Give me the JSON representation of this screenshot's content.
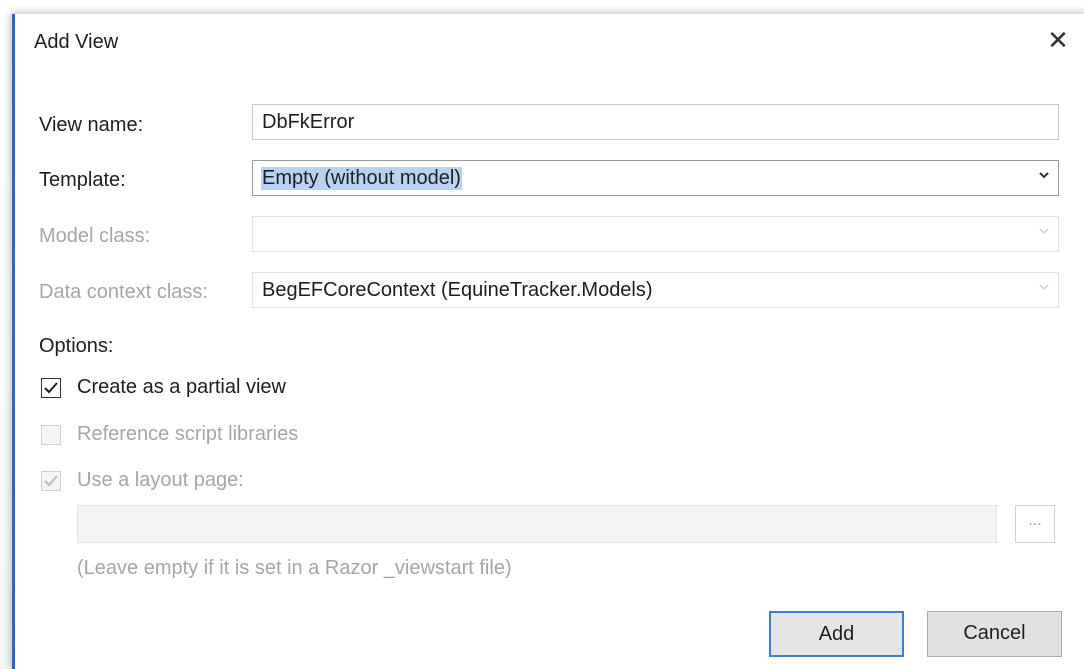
{
  "dialog": {
    "title": "Add View",
    "close_icon": "close-icon"
  },
  "form": {
    "view_name_label": "View name:",
    "view_name_value": "DbFkError",
    "template_label": "Template:",
    "template_value": "Empty (without model)",
    "model_class_label": "Model class:",
    "model_class_value": "",
    "data_context_label": "Data context class:",
    "data_context_value": "BegEFCoreContext (EquineTracker.Models)",
    "options_label": "Options:"
  },
  "options": {
    "partial_view": {
      "label": "Create as a partial view",
      "checked": true,
      "enabled": true
    },
    "script_libraries": {
      "label": "Reference script libraries",
      "checked": false,
      "enabled": false
    },
    "layout_page": {
      "label": "Use a layout page:",
      "checked": true,
      "enabled": false
    }
  },
  "layout": {
    "path_value": "",
    "browse_label": "...",
    "hint": "(Leave empty if it is set in a Razor _viewstart file)"
  },
  "buttons": {
    "add_label": "Add",
    "cancel_label": "Cancel"
  },
  "colors": {
    "accent": "#3c7fd1",
    "selection": "#b8d3f2",
    "disabled_text": "#a6a6a6"
  }
}
